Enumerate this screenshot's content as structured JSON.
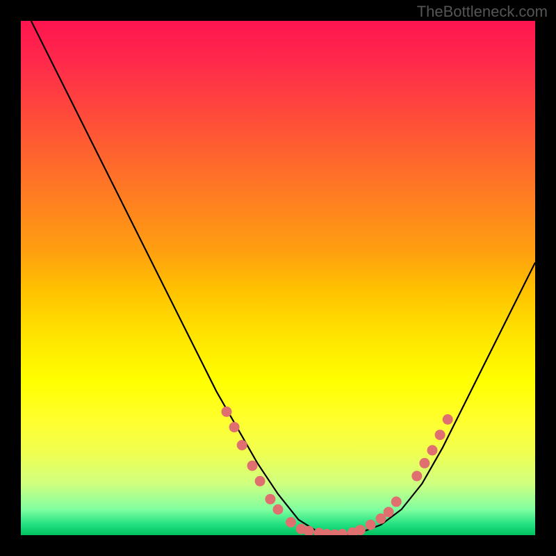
{
  "watermark": "TheBottleneck.com",
  "chart_data": {
    "type": "line",
    "title": "",
    "xlabel": "",
    "ylabel": "",
    "xlim": [
      0,
      100
    ],
    "ylim": [
      0,
      100
    ],
    "grid": false,
    "legend": false,
    "series": [
      {
        "name": "bottleneck-curve",
        "x": [
          2,
          6,
          10,
          14,
          18,
          22,
          26,
          30,
          34,
          38,
          42,
          46,
          50,
          54,
          58,
          62,
          66,
          70,
          74,
          78,
          82,
          86,
          90,
          94,
          98,
          100
        ],
        "y": [
          100,
          92,
          84,
          76,
          68,
          60,
          52,
          44,
          36,
          28,
          21,
          14,
          8,
          3,
          0.5,
          0,
          0.5,
          2,
          5,
          10,
          17,
          25,
          33,
          41,
          49,
          53
        ],
        "color": "#000000"
      }
    ],
    "highlight_points": {
      "name": "selected-range",
      "color": "#e07070",
      "points": [
        {
          "x": 40,
          "y": 24
        },
        {
          "x": 41.5,
          "y": 21
        },
        {
          "x": 43,
          "y": 17.5
        },
        {
          "x": 45,
          "y": 13.5
        },
        {
          "x": 46.5,
          "y": 10.5
        },
        {
          "x": 48.5,
          "y": 7
        },
        {
          "x": 50,
          "y": 5
        },
        {
          "x": 52.5,
          "y": 2.5
        },
        {
          "x": 54.5,
          "y": 1.2
        },
        {
          "x": 56,
          "y": 0.8
        },
        {
          "x": 58,
          "y": 0.4
        },
        {
          "x": 59.5,
          "y": 0.2
        },
        {
          "x": 61,
          "y": 0.1
        },
        {
          "x": 62.5,
          "y": 0.2
        },
        {
          "x": 64.5,
          "y": 0.5
        },
        {
          "x": 66,
          "y": 1
        },
        {
          "x": 68,
          "y": 2
        },
        {
          "x": 70,
          "y": 3.2
        },
        {
          "x": 71.5,
          "y": 4.5
        },
        {
          "x": 73,
          "y": 6.5
        },
        {
          "x": 77,
          "y": 11.5
        },
        {
          "x": 78.5,
          "y": 14
        },
        {
          "x": 80,
          "y": 16.5
        },
        {
          "x": 81.5,
          "y": 19.5
        },
        {
          "x": 83,
          "y": 22.5
        }
      ]
    },
    "gradient": {
      "top_color": "#ff1450",
      "mid_color": "#ffff00",
      "bottom_color": "#00c060"
    }
  }
}
